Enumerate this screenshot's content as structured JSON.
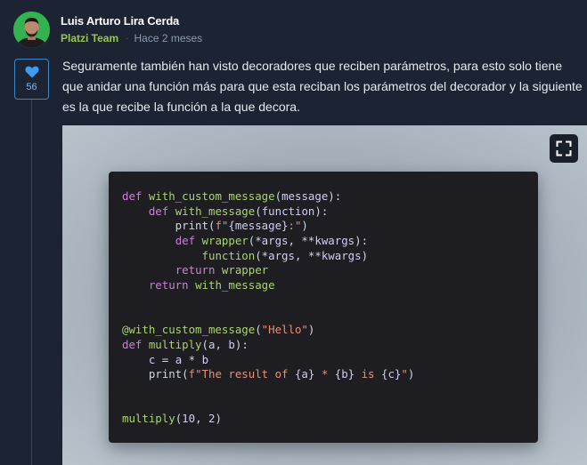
{
  "author": {
    "name": "Luis Arturo Lira Cerda",
    "team": "Platzi Team",
    "separator": "·",
    "time": "Hace 2 meses"
  },
  "likes": {
    "count": "56",
    "icon": "heart-icon"
  },
  "comment": {
    "text": "Seguramente también han visto decoradores que reciben parámetros, para esto solo tiene que anidar una función más para que esta reciban los parámetros del decorador y la siguiente es la que recibe la función a la que decora."
  },
  "expand_icon": "expand-icon",
  "colors": {
    "team": "#98ca3f",
    "like_border": "#3a86c8",
    "keyword": "#c981d3",
    "function": "#a9d36f",
    "string": "#e58f78"
  },
  "code_lines": [
    [
      {
        "t": "kw",
        "v": "def "
      },
      {
        "t": "fn",
        "v": "with_custom_message"
      },
      {
        "t": "p",
        "v": "("
      },
      {
        "t": "id",
        "v": "message"
      },
      {
        "t": "p",
        "v": "):"
      }
    ],
    [
      {
        "t": "p",
        "v": "    "
      },
      {
        "t": "kw",
        "v": "def "
      },
      {
        "t": "fn",
        "v": "with_message"
      },
      {
        "t": "p",
        "v": "("
      },
      {
        "t": "id",
        "v": "function"
      },
      {
        "t": "p",
        "v": "):"
      }
    ],
    [
      {
        "t": "p",
        "v": "        print("
      },
      {
        "t": "str",
        "v": "f\""
      },
      {
        "t": "id",
        "v": "{message}"
      },
      {
        "t": "str",
        "v": ":\""
      },
      {
        "t": "p",
        "v": ")"
      }
    ],
    [
      {
        "t": "p",
        "v": "        "
      },
      {
        "t": "kw",
        "v": "def "
      },
      {
        "t": "fn",
        "v": "wrapper"
      },
      {
        "t": "p",
        "v": "(*"
      },
      {
        "t": "id",
        "v": "args"
      },
      {
        "t": "p",
        "v": ", **"
      },
      {
        "t": "id",
        "v": "kwargs"
      },
      {
        "t": "p",
        "v": "):"
      }
    ],
    [
      {
        "t": "p",
        "v": "            "
      },
      {
        "t": "fn",
        "v": "function"
      },
      {
        "t": "p",
        "v": "(*"
      },
      {
        "t": "id",
        "v": "args"
      },
      {
        "t": "p",
        "v": ", **"
      },
      {
        "t": "id",
        "v": "kwargs"
      },
      {
        "t": "p",
        "v": ")"
      }
    ],
    [
      {
        "t": "p",
        "v": "        "
      },
      {
        "t": "kw",
        "v": "return "
      },
      {
        "t": "fn",
        "v": "wrapper"
      }
    ],
    [
      {
        "t": "p",
        "v": "    "
      },
      {
        "t": "kw",
        "v": "return "
      },
      {
        "t": "fn",
        "v": "with_message"
      }
    ],
    [],
    [],
    [
      {
        "t": "fn",
        "v": "@with_custom_message"
      },
      {
        "t": "p",
        "v": "("
      },
      {
        "t": "str",
        "v": "\"Hello\""
      },
      {
        "t": "p",
        "v": ")"
      }
    ],
    [
      {
        "t": "kw",
        "v": "def "
      },
      {
        "t": "fn",
        "v": "multiply"
      },
      {
        "t": "p",
        "v": "("
      },
      {
        "t": "id",
        "v": "a"
      },
      {
        "t": "p",
        "v": ", "
      },
      {
        "t": "id",
        "v": "b"
      },
      {
        "t": "p",
        "v": "):"
      }
    ],
    [
      {
        "t": "p",
        "v": "    "
      },
      {
        "t": "id",
        "v": "c"
      },
      {
        "t": "p",
        "v": " = "
      },
      {
        "t": "id",
        "v": "a"
      },
      {
        "t": "p",
        "v": " * "
      },
      {
        "t": "id",
        "v": "b"
      }
    ],
    [
      {
        "t": "p",
        "v": "    print("
      },
      {
        "t": "str",
        "v": "f\"The result of "
      },
      {
        "t": "id",
        "v": "{a}"
      },
      {
        "t": "str",
        "v": " * "
      },
      {
        "t": "id",
        "v": "{b}"
      },
      {
        "t": "str",
        "v": " is "
      },
      {
        "t": "id",
        "v": "{c}"
      },
      {
        "t": "str",
        "v": "\""
      },
      {
        "t": "p",
        "v": ")"
      }
    ],
    [],
    [],
    [
      {
        "t": "fn",
        "v": "multiply"
      },
      {
        "t": "p",
        "v": "("
      },
      {
        "t": "num",
        "v": "10"
      },
      {
        "t": "p",
        "v": ", "
      },
      {
        "t": "num",
        "v": "2"
      },
      {
        "t": "p",
        "v": ")"
      }
    ]
  ]
}
